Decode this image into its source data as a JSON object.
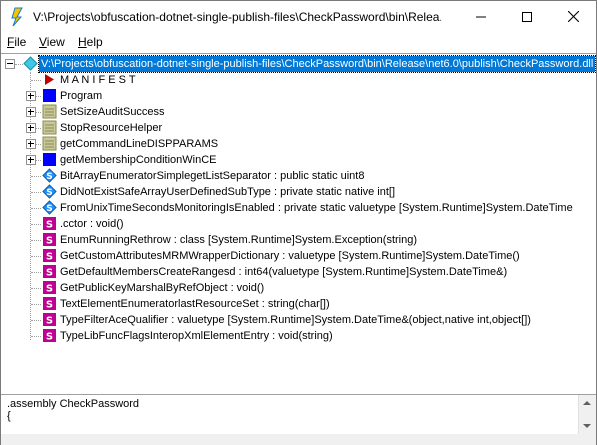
{
  "window": {
    "title": "V:\\Projects\\obfuscation-dotnet-single-publish-files\\CheckPassword\\bin\\Relea...",
    "app_icon": "ildasm-icon"
  },
  "menu": {
    "file": "File",
    "view": "View",
    "help": "Help"
  },
  "tree": {
    "root": {
      "label": "V:\\Projects\\obfuscation-dotnet-single-publish-files\\CheckPassword\\bin\\Release\\net6.0\\publish\\CheckPassword.dll",
      "icon": "assembly-icon",
      "expanded": true,
      "selected": true
    },
    "items": [
      {
        "label": "M A N I F E S T",
        "icon": "manifest-icon",
        "expander": ""
      },
      {
        "label": "Program",
        "icon": "class-icon",
        "expander": "plus"
      },
      {
        "label": "SetSizeAuditSuccess",
        "icon": "enum-class-icon",
        "expander": "plus"
      },
      {
        "label": "StopResourceHelper",
        "icon": "enum-class-icon",
        "expander": "plus"
      },
      {
        "label": "getCommandLineDISPPARAMS",
        "icon": "enum-class-icon",
        "expander": "plus"
      },
      {
        "label": "getMembershipConditionWinCE",
        "icon": "class-icon",
        "expander": "plus"
      },
      {
        "label": "BitArrayEnumeratorSimplegetListSeparator : public static uint8",
        "icon": "field-icon",
        "expander": ""
      },
      {
        "label": "DidNotExistSafeArrayUserDefinedSubType : private static native int[]",
        "icon": "field-icon",
        "expander": ""
      },
      {
        "label": "FromUnixTimeSecondsMonitoringIsEnabled : private static valuetype [System.Runtime]System.DateTime",
        "icon": "field-icon",
        "expander": ""
      },
      {
        "label": ".cctor : void()",
        "icon": "method-icon",
        "expander": ""
      },
      {
        "label": "EnumRunningRethrow : class [System.Runtime]System.Exception(string)",
        "icon": "method-icon",
        "expander": ""
      },
      {
        "label": "GetCustomAttributesMRMWrapperDictionary : valuetype [System.Runtime]System.DateTime()",
        "icon": "method-icon",
        "expander": ""
      },
      {
        "label": "GetDefaultMembersCreateRangesd : int64(valuetype [System.Runtime]System.DateTime&)",
        "icon": "method-icon",
        "expander": ""
      },
      {
        "label": "GetPublicKeyMarshalByRefObject : void()",
        "icon": "method-icon",
        "expander": ""
      },
      {
        "label": "TextElementEnumeratorlastResourceSet : string(char[])",
        "icon": "method-icon",
        "expander": ""
      },
      {
        "label": "TypeFilterAceQualifier : valuetype [System.Runtime]System.DateTime&(object,native int,object[])",
        "icon": "method-icon",
        "expander": ""
      },
      {
        "label": "TypeLibFuncFlagsInteropXmlElementEntry : void(string)",
        "icon": "method-icon",
        "expander": ""
      }
    ]
  },
  "bottom": {
    "line1": ".assembly CheckPassword",
    "line2": "{"
  },
  "colors": {
    "selection": "#0078d7",
    "class": "#0000ff",
    "enum_class": "#c8c896",
    "field": "#1e90ff",
    "method": "#c00090",
    "manifest": "#c00000"
  }
}
